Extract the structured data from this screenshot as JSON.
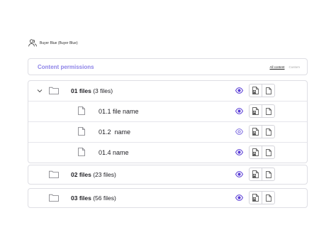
{
  "user": {
    "name": "Buyer Blue (Buyer Blue)",
    "icon": "users-icon"
  },
  "permissions": {
    "title": "Content permissions",
    "tabs": {
      "all": "All content",
      "custom": "Custom"
    }
  },
  "folders": [
    {
      "name": "01 files",
      "count": "(3 files)",
      "expanded": true,
      "files": [
        "01.1 file name",
        "01.2  name",
        "01.4 name"
      ]
    },
    {
      "name": "02 files",
      "count": "(23 files)",
      "expanded": false
    },
    {
      "name": "03 files",
      "count": "(56 files)",
      "expanded": false
    }
  ],
  "colors": {
    "accent": "#5b3fd6",
    "title": "#8d83e8",
    "border": "#dedee4"
  }
}
